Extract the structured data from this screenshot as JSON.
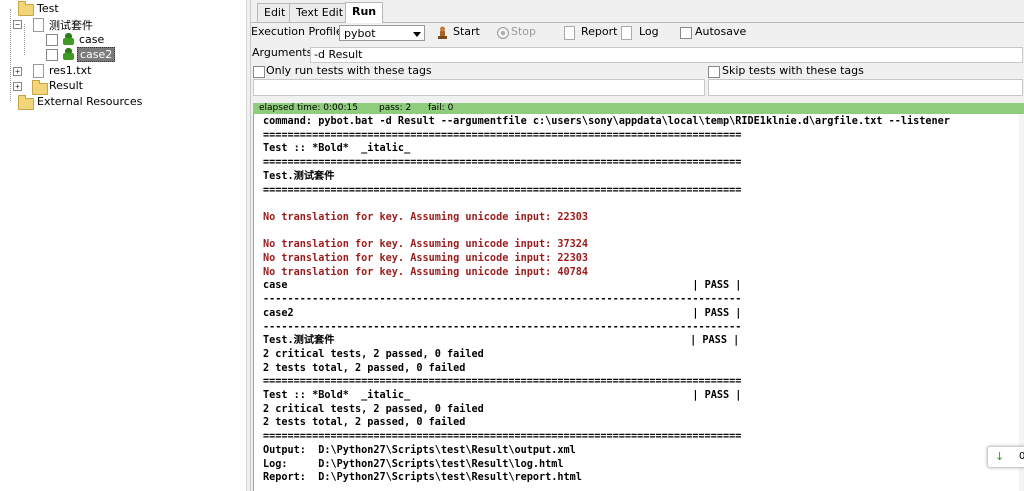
{
  "tree": {
    "root": "Test",
    "suite": "测试套件",
    "tests": [
      "case",
      "case2"
    ],
    "resource": "res1.txt",
    "result_folder": "Result",
    "external": "External Resources"
  },
  "tabs": [
    "Edit",
    "Text Edit",
    "Run"
  ],
  "toolbar": {
    "profile_label": "Execution Profile:",
    "profile_value": "pybot",
    "start": "Start",
    "stop": "Stop",
    "report": "Report",
    "log": "Log",
    "autosave": "Autosave"
  },
  "arguments": {
    "label": "Arguments:",
    "value": "-d Result"
  },
  "tags": {
    "only_run": "Only run tests with these tags",
    "skip": "Skip tests with these tags"
  },
  "status": {
    "elapsed": "elapsed time: 0:00:15",
    "pass": "pass: 2",
    "fail": "fail: 0",
    "color": "#8fcd7c"
  },
  "console_lines": [
    {
      "t": "command: pybot.bat -d Result --argumentfile c:\\users\\sony\\appdata\\local\\temp\\RIDE1klnie.d\\argfile.txt --listener",
      "c": "n"
    },
    {
      "t": "==============================================================================",
      "c": "n"
    },
    {
      "t": "Test :: *Bold*  _italic_",
      "c": "n"
    },
    {
      "t": "==============================================================================",
      "c": "n"
    },
    {
      "t": "Test.测试套件",
      "c": "n"
    },
    {
      "t": "==============================================================================",
      "c": "n"
    },
    {
      "t": "",
      "c": "n"
    },
    {
      "t": "No translation for key. Assuming unicode input: 22303",
      "c": "red"
    },
    {
      "t": "",
      "c": "n"
    },
    {
      "t": "No translation for key. Assuming unicode input: 37324",
      "c": "red"
    },
    {
      "t": "No translation for key. Assuming unicode input: 22303",
      "c": "red"
    },
    {
      "t": "No translation for key. Assuming unicode input: 40784",
      "c": "red"
    },
    {
      "t": "case                                                                  | PASS |",
      "c": "n"
    },
    {
      "t": "------------------------------------------------------------------------------",
      "c": "n"
    },
    {
      "t": "case2                                                                 | PASS |",
      "c": "n"
    },
    {
      "t": "------------------------------------------------------------------------------",
      "c": "n"
    },
    {
      "t": "Test.测试套件                                                          | PASS |",
      "c": "n"
    },
    {
      "t": "2 critical tests, 2 passed, 0 failed",
      "c": "n"
    },
    {
      "t": "2 tests total, 2 passed, 0 failed",
      "c": "n"
    },
    {
      "t": "==============================================================================",
      "c": "n"
    },
    {
      "t": "Test :: *Bold*  _italic_                                              | PASS |",
      "c": "n"
    },
    {
      "t": "2 critical tests, 2 passed, 0 failed",
      "c": "n"
    },
    {
      "t": "2 tests total, 2 passed, 0 failed",
      "c": "n"
    },
    {
      "t": "==============================================================================",
      "c": "n"
    },
    {
      "t": "Output:  D:\\Python27\\Scripts\\test\\Result\\output.xml",
      "c": "n"
    },
    {
      "t": "Log:     D:\\Python27\\Scripts\\test\\Result\\log.html",
      "c": "n"
    },
    {
      "t": "Report:  D:\\Python27\\Scripts\\test\\Result\\report.html",
      "c": "n"
    }
  ],
  "toast": {
    "arrow": "↓",
    "text": "0"
  }
}
